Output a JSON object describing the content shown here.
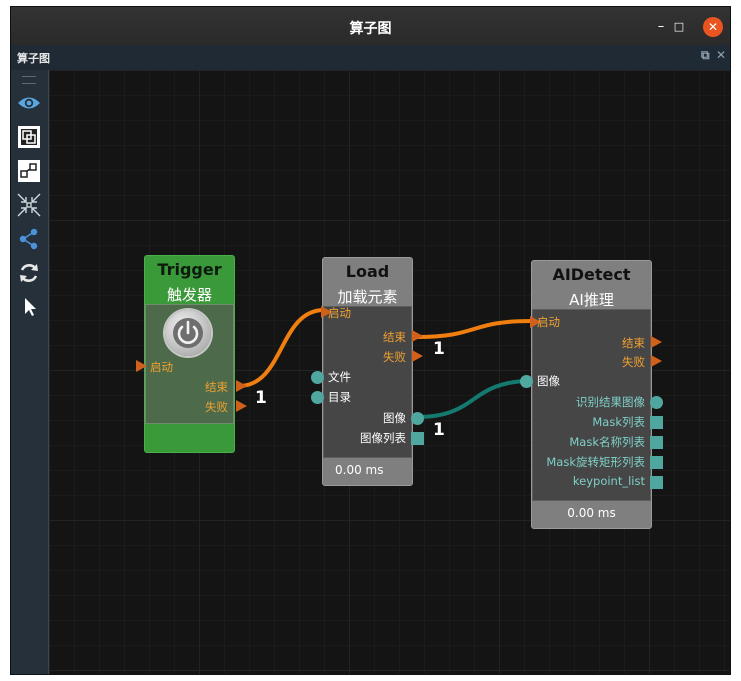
{
  "window": {
    "title": "算子图",
    "buttons": {
      "minimize": "–",
      "maximize": "□",
      "close": "✕"
    }
  },
  "panel": {
    "title": "算子图",
    "float_icon": "⧉",
    "close_icon": "✕"
  },
  "toolbar": {
    "icons": [
      "eye-icon",
      "frame-icon",
      "connect-nodes-icon",
      "collapse-icon",
      "share-nodes-icon",
      "refresh-icon",
      "pointer-icon"
    ]
  },
  "nodes": {
    "trigger": {
      "title": "Trigger",
      "subtitle": "触发器",
      "color": "#3a9a3a",
      "inputs": [
        "启动"
      ],
      "outputs": [
        "结束",
        "失败"
      ]
    },
    "load": {
      "title": "Load",
      "subtitle": "加载元素",
      "inputs": [
        "启动",
        "文件",
        "目录"
      ],
      "outputs": [
        "结束",
        "失败",
        "图像",
        "图像列表"
      ],
      "timing": "0.00 ms"
    },
    "aidetect": {
      "title": "AIDetect",
      "subtitle": "AI推理",
      "inputs": [
        "启动",
        "图像"
      ],
      "outputs": [
        "结束",
        "失败",
        "识别结果图像",
        "Mask列表",
        "Mask名称列表",
        "Mask旋转矩形列表",
        "keypoint_list"
      ],
      "timing": "0.00 ms"
    }
  },
  "links": [
    {
      "from": "trigger.结束",
      "to": "load.启动",
      "count": "1",
      "color": "#f07f10"
    },
    {
      "from": "load.结束",
      "to": "aidetect.启动",
      "count": "1",
      "color": "#f07f10"
    },
    {
      "from": "load.图像",
      "to": "aidetect.图像",
      "count": "1",
      "color": "#147a70"
    }
  ]
}
